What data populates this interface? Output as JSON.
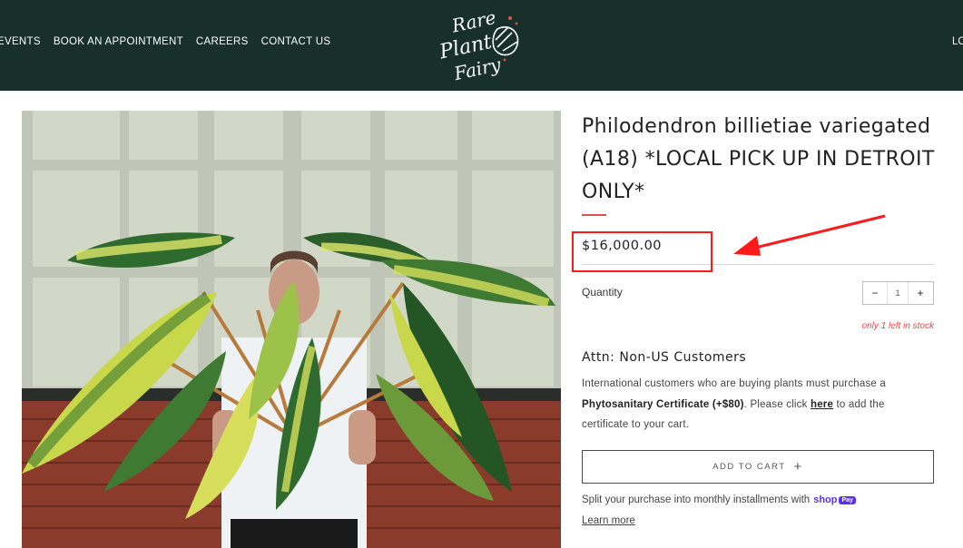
{
  "nav": {
    "items": [
      "EVENTS",
      "BOOK AN APPOINTMENT",
      "CAREERS",
      "CONTACT US"
    ],
    "right_item": "LO"
  },
  "logo": {
    "line1": "Rare",
    "line2": "Plant",
    "line3": "Fairy"
  },
  "product": {
    "title": "Philodendron billietiae variegated (A18) *LOCAL PICK UP IN DETROIT ONLY*",
    "price": "$16,000.00",
    "quantity_label": "Quantity",
    "quantity_value": "1",
    "decrement": "−",
    "increment": "+",
    "stock": "only 1 left in stock"
  },
  "notice": {
    "heading": "Attn: Non-US Customers",
    "text1": "International customers who are buying plants must purchase a ",
    "bold": "Phytosanitary Certificate (+$80)",
    "text2": ". Please click ",
    "link": "here",
    "text3": " to add the certificate to your cart."
  },
  "cart": {
    "label": "ADD TO CART",
    "icon": "+"
  },
  "installments": {
    "text": "Split your purchase into monthly installments with",
    "brand": "shop",
    "brand_badge": "Pay",
    "learn_more": "Learn more"
  },
  "colors": {
    "header_bg": "#17302a",
    "accent_red": "#e05050",
    "highlight": "#ff1a1a",
    "shop_pay": "#5a31f4"
  }
}
